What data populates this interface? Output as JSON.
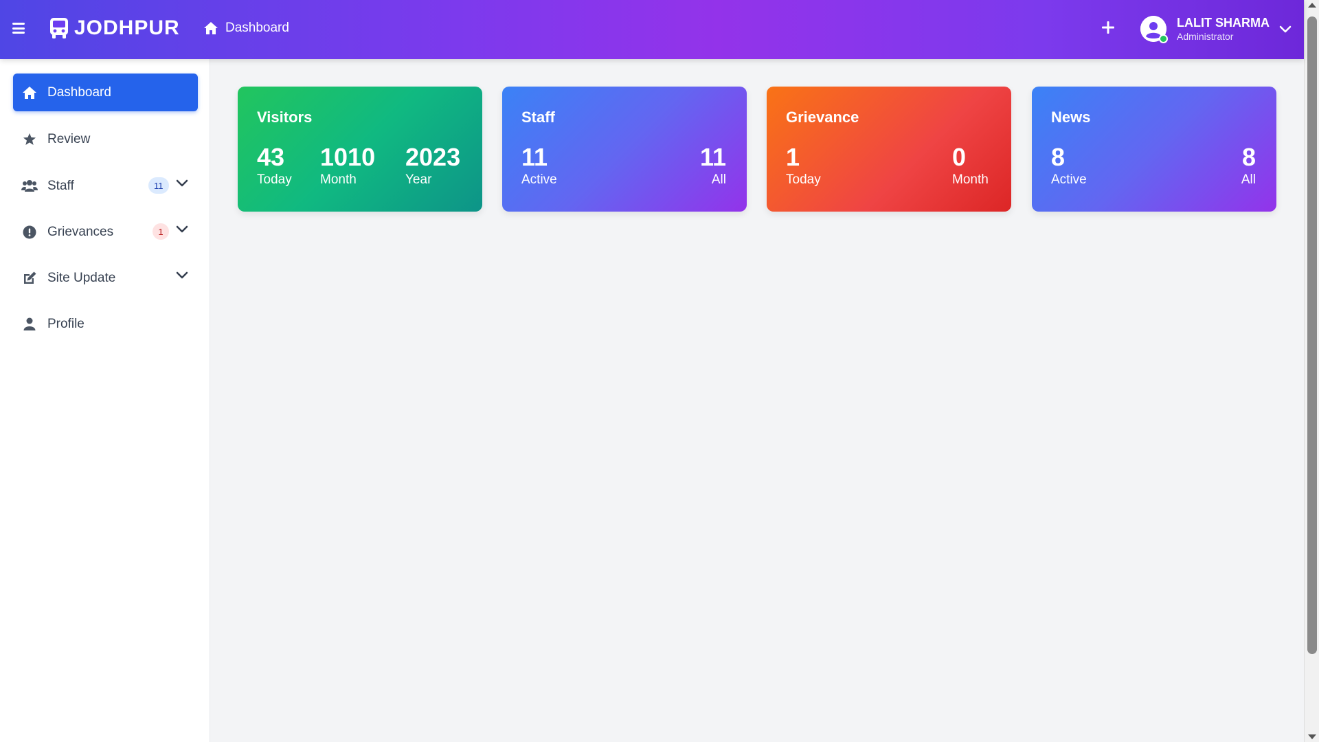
{
  "header": {
    "brand": "JODHPUR",
    "breadcrumb": "Dashboard",
    "add_icon": "plus-icon",
    "user": {
      "name": "LALIT SHARMA",
      "role": "Administrator",
      "status": "online"
    }
  },
  "sidebar": {
    "items": [
      {
        "label": "Dashboard",
        "icon": "home-icon",
        "active": true
      },
      {
        "label": "Review",
        "icon": "star-icon"
      },
      {
        "label": "Staff",
        "icon": "users-icon",
        "badge": "11",
        "expandable": true
      },
      {
        "label": "Grievances",
        "icon": "exclamation-circle-icon",
        "badge": "1",
        "expandable": true
      },
      {
        "label": "Site Update",
        "icon": "edit-icon",
        "expandable": true
      },
      {
        "label": "Profile",
        "icon": "user-icon"
      }
    ]
  },
  "cards": {
    "visitors": {
      "title": "Visitors",
      "stats": [
        {
          "value": "43",
          "label": "Today"
        },
        {
          "value": "1010",
          "label": "Month"
        },
        {
          "value": "2023",
          "label": "Year"
        }
      ]
    },
    "staff": {
      "title": "Staff",
      "stats": [
        {
          "value": "11",
          "label": "Active"
        },
        {
          "value": "11",
          "label": "All"
        }
      ]
    },
    "grievance": {
      "title": "Grievance",
      "stats": [
        {
          "value": "1",
          "label": "Today"
        },
        {
          "value": "0",
          "label": "Month"
        }
      ]
    },
    "news": {
      "title": "News",
      "stats": [
        {
          "value": "8",
          "label": "Active"
        },
        {
          "value": "8",
          "label": "All"
        }
      ]
    }
  },
  "colors": {
    "header_gradient": [
      "#4f46e5",
      "#9333ea"
    ],
    "active_nav": "#2563eb",
    "visitors_card": [
      "#22c55e",
      "#0d9488"
    ],
    "staff_card": [
      "#3b82f6",
      "#9333ea"
    ],
    "grievance_card": [
      "#f97316",
      "#dc2626"
    ],
    "news_card": [
      "#3b82f6",
      "#9333ea"
    ],
    "online": "#22c55e"
  }
}
